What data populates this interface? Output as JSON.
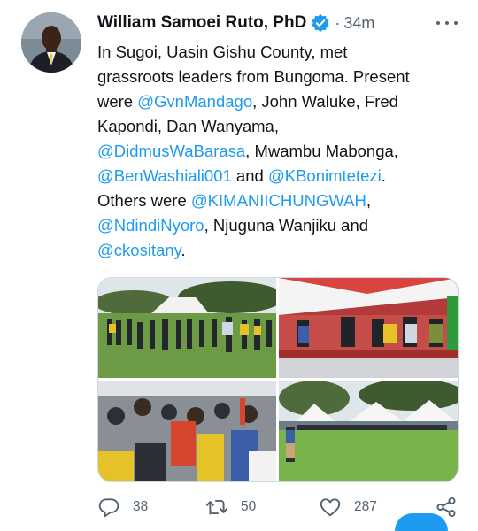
{
  "tweet": {
    "author_name": "William Samoei Ruto, PhD",
    "separator": "·",
    "time": "34m",
    "verified_icon": "verified-badge-icon",
    "text_lines": [
      [
        {
          "t": "In Sugoi, Uasin Gishu County, met",
          "m": false
        }
      ],
      [
        {
          "t": "grassroots leaders from Bungoma. Present",
          "m": false
        }
      ],
      [
        {
          "t": "were ",
          "m": false
        },
        {
          "t": "@GvnMandago",
          "m": true
        },
        {
          "t": ", John Waluke, Fred",
          "m": false
        }
      ],
      [
        {
          "t": "Kapondi, Dan Wanyama,",
          "m": false
        }
      ],
      [
        {
          "t": "@DidmusWaBarasa",
          "m": true
        },
        {
          "t": ", Mwambu Mabonga,",
          "m": false
        }
      ],
      [
        {
          "t": "@BenWashiali001",
          "m": true
        },
        {
          "t": " and ",
          "m": false
        },
        {
          "t": "@KBonimtetezi",
          "m": true
        },
        {
          "t": ".",
          "m": false
        }
      ],
      [
        {
          "t": "Others were ",
          "m": false
        },
        {
          "t": "@KIMANIICHUNGWAH",
          "m": true
        },
        {
          "t": ",",
          "m": false
        }
      ],
      [
        {
          "t": "@NdindiNyoro",
          "m": true
        },
        {
          "t": ", Njuguna Wanjiku and",
          "m": false
        }
      ],
      [
        {
          "t": "@ckositany",
          "m": true
        },
        {
          "t": ".",
          "m": false
        }
      ]
    ]
  },
  "actions": {
    "reply_count": "38",
    "retweet_count": "50",
    "like_count": "287"
  },
  "colors": {
    "accent": "#1d9bf0",
    "text": "#0f1419",
    "secondary": "#536471"
  }
}
